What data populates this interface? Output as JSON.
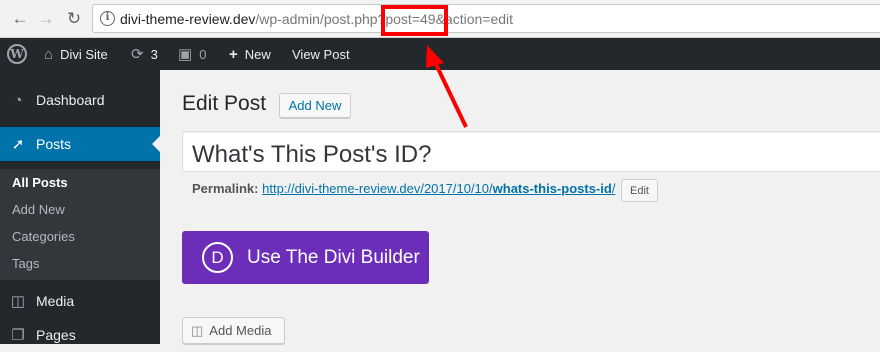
{
  "browser": {
    "back_icon": "back-arrow-icon",
    "forward_icon": "forward-arrow-icon",
    "reload_icon": "reload-icon",
    "url_host": "divi-theme-review.dev",
    "url_path": "/wp-admin/post.php",
    "url_query": "?post=49&action=edit"
  },
  "adminbar": {
    "site_name": "Divi Site",
    "updates_count": "3",
    "comments_count": "0",
    "new_label": "New",
    "view_post_label": "View Post"
  },
  "sidebar": {
    "items": [
      {
        "label": "Dashboard",
        "icon": "dashboard-icon"
      },
      {
        "label": "Posts",
        "icon": "pin-icon"
      },
      {
        "label": "Media",
        "icon": "media-icon"
      },
      {
        "label": "Pages",
        "icon": "pages-icon"
      }
    ],
    "submenu": [
      "All Posts",
      "Add New",
      "Categories",
      "Tags"
    ]
  },
  "main": {
    "title": "Edit Post",
    "add_new_label": "Add New",
    "post_title": "What's This Post's ID?",
    "permalink_label": "Permalink:",
    "permalink_base": "http://divi-theme-review.dev/2017/10/10/",
    "permalink_slug": "whats-this-posts-id",
    "permalink_trail": "/",
    "edit_label": "Edit",
    "divi_builder_label": "Use The Divi Builder",
    "divi_logo_letter": "D",
    "add_media_label": "Add Media"
  },
  "colors": {
    "accent": "#0073aa",
    "divi_purple": "#6c2eb9",
    "highlight_red": "#ff0000",
    "admin_dark": "#23282d"
  }
}
